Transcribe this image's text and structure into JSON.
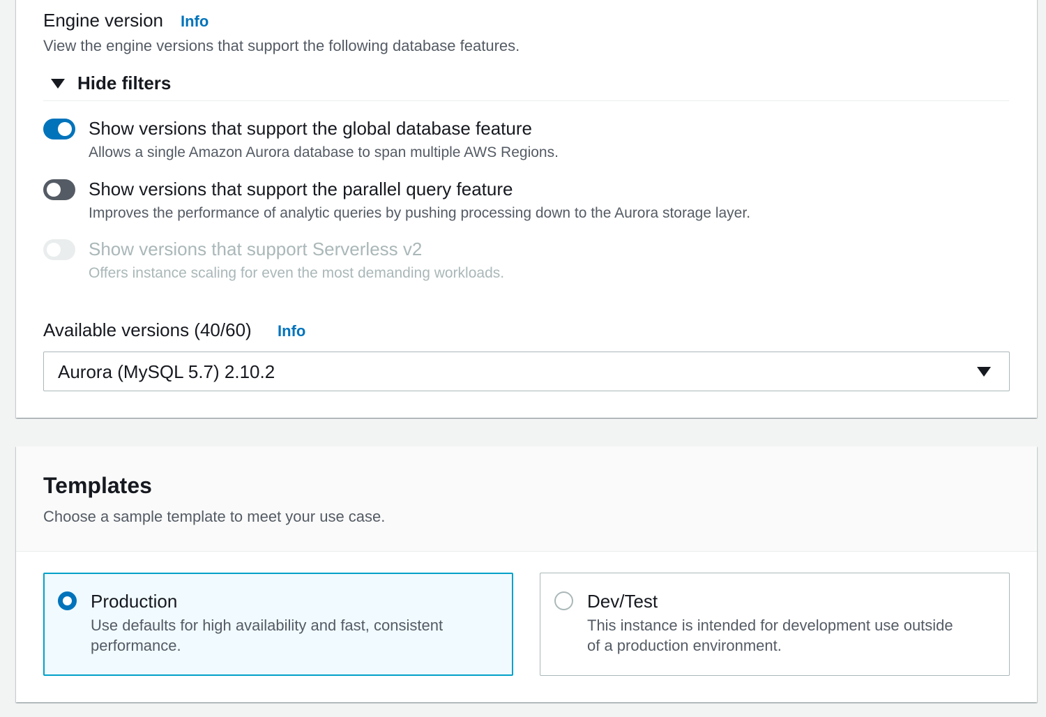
{
  "engine_version": {
    "label": "Engine version",
    "info": "Info",
    "description": "View the engine versions that support the following database features.",
    "hide_filters": "Hide filters",
    "filters": [
      {
        "title": "Show versions that support the global database feature",
        "description": "Allows a single Amazon Aurora database to span multiple AWS Regions.",
        "state": "on"
      },
      {
        "title": "Show versions that support the parallel query feature",
        "description": "Improves the performance of analytic queries by pushing processing down to the Aurora storage layer.",
        "state": "off"
      },
      {
        "title": "Show versions that support Serverless v2",
        "description": "Offers instance scaling for even the most demanding workloads.",
        "state": "disabled"
      }
    ],
    "available_versions_label": "Available versions (40/60)",
    "available_versions_info": "Info",
    "selected_version": "Aurora (MySQL 5.7) 2.10.2"
  },
  "templates": {
    "title": "Templates",
    "description": "Choose a sample template to meet your use case.",
    "options": [
      {
        "title": "Production",
        "description_line1": "Use defaults for high availability and fast, consistent",
        "description_line2": "performance.",
        "selected": true
      },
      {
        "title": "Dev/Test",
        "description_line1": "This instance is intended for development use outside",
        "description_line2": "of a production environment.",
        "selected": false
      }
    ]
  },
  "colors": {
    "accent": "#0073bb",
    "selected_border": "#00a1c9",
    "selected_bg": "#f1faff",
    "background": "#f2f3f3"
  }
}
